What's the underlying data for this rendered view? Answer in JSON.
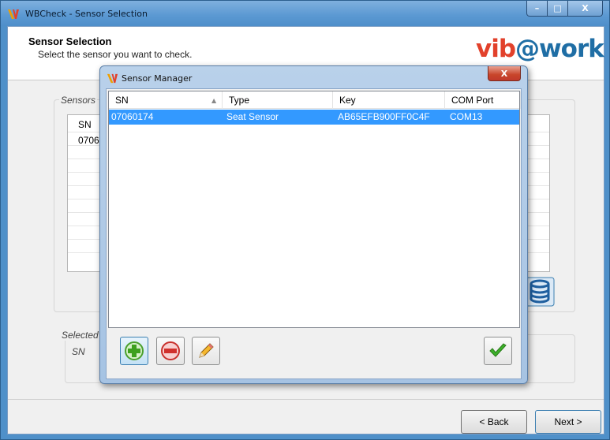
{
  "window": {
    "title": "WBCheck - Sensor Selection",
    "min_glyph": "–",
    "max_glyph": "□",
    "close_glyph": "X"
  },
  "header": {
    "title": "Sensor Selection",
    "subtitle": "Select the sensor you want to check.",
    "logo_left": "vib",
    "logo_right": "@work"
  },
  "sensors_group": {
    "legend": "Sensors",
    "col_sn": "SN",
    "row_sn_partial": "0706"
  },
  "selected_group": {
    "legend": "Selected",
    "sn_label": "SN"
  },
  "footer": {
    "back_label": "< Back",
    "next_label": "Next >"
  },
  "dialog": {
    "title": "Sensor Manager",
    "close_glyph": "X",
    "columns": [
      "SN",
      "Type",
      "Key",
      "COM Port"
    ],
    "rows": [
      {
        "sn": "07060174",
        "type": "Seat Sensor",
        "key": "AB65EFB900FF0C4F",
        "com": "COM13"
      }
    ],
    "sort_glyph": "▲"
  },
  "colors": {
    "selection": "#3399ff",
    "logo_red": "#e2412b",
    "logo_blue": "#1f6ea5"
  }
}
